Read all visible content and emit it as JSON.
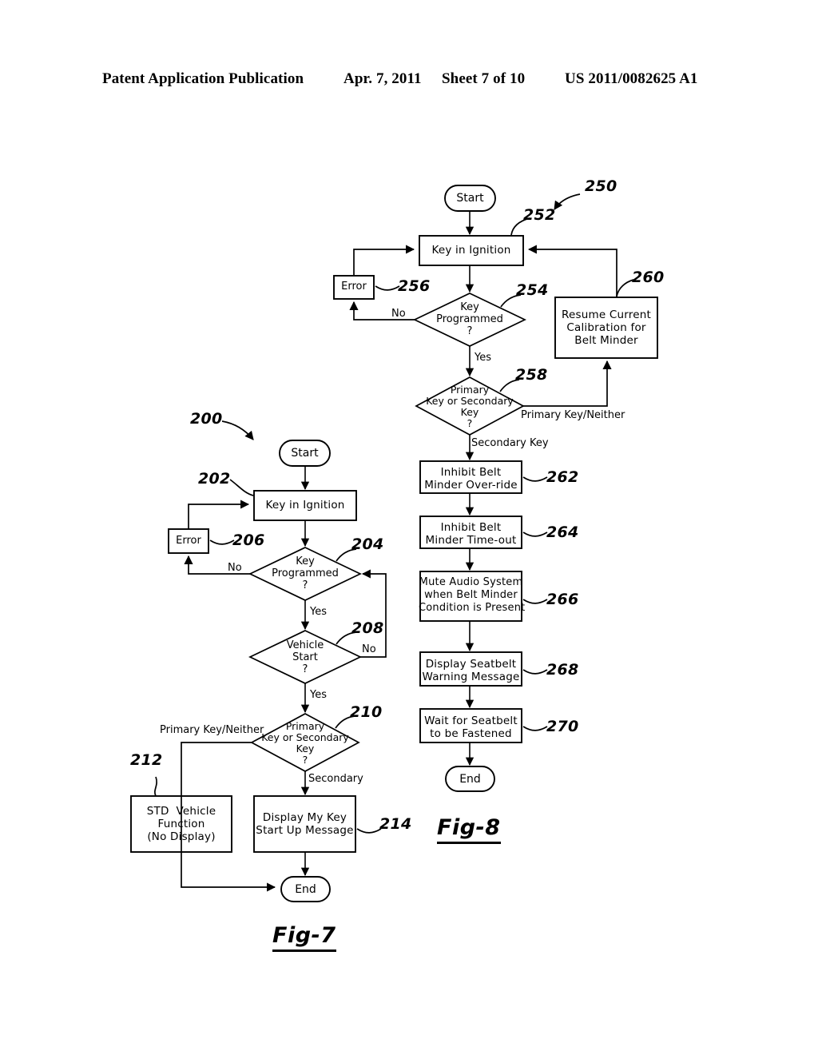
{
  "header": {
    "publication": "Patent Application Publication",
    "date": "Apr. 7, 2011",
    "sheet": "Sheet 7 of 10",
    "patent_number": "US 2011/0082625 A1"
  },
  "figures": [
    {
      "caption": "Fig-7",
      "ref": "200",
      "nodes": {
        "start": "Start",
        "key_in_ignition": "Key in Ignition",
        "error": "Error",
        "key_programmed": "Key\nProgrammed\n?",
        "vehicle_start": "Vehicle\nStart\n?",
        "primary_or_secondary": "Primary\nKey or Secondary\nKey\n?",
        "std_vehicle_function": "STD  Vehicle\nFunction\n(No Display)",
        "display_my_key": "Display My Key\nStart Up Message",
        "end": "End"
      },
      "edge_labels": {
        "no_key_programmed": "No",
        "yes_key_programmed": "Yes",
        "no_vehicle_start": "No",
        "yes_vehicle_start": "Yes",
        "secondary": "Secondary",
        "primary_or_neither": "Primary Key/Neither"
      },
      "ref_numbers": {
        "flow": "200",
        "key_in_ignition": "202",
        "key_programmed": "204",
        "error": "206",
        "vehicle_start": "208",
        "primary_or_secondary": "210",
        "std_vehicle_function": "212",
        "display_my_key": "214"
      }
    },
    {
      "caption": "Fig-8",
      "ref": "250",
      "nodes": {
        "start": "Start",
        "key_in_ignition": "Key in Ignition",
        "error": "Error",
        "key_programmed": "Key\nProgrammed\n?",
        "primary_or_secondary": "Primary\nKey or Secondary\nKey\n?",
        "resume_calibration": "Resume Current\nCalibration for\nBelt Minder",
        "inhibit_override": "Inhibit Belt\nMinder Over-ride",
        "inhibit_timeout": "Inhibit Belt\nMinder Time-out",
        "mute_audio": "Mute Audio System\nwhen Belt Minder\nCondition is Present",
        "display_seatbelt_warning": "Display Seatbelt\nWarning Message",
        "wait_seatbelt": "Wait for Seatbelt\nto be Fastened",
        "end": "End"
      },
      "edge_labels": {
        "no_key_programmed": "No",
        "yes_key_programmed": "Yes",
        "secondary_key": "Secondary Key",
        "primary_key_neither": "Primary Key/Neither"
      },
      "ref_numbers": {
        "flow": "250",
        "key_in_ignition": "252",
        "key_programmed": "254",
        "error": "256",
        "primary_or_secondary": "258",
        "resume_calibration": "260",
        "inhibit_override": "262",
        "inhibit_timeout": "264",
        "mute_audio": "266",
        "display_seatbelt_warning": "268",
        "wait_seatbelt": "270"
      }
    }
  ],
  "colors": {
    "ink": "#000000",
    "paper": "#ffffff"
  }
}
